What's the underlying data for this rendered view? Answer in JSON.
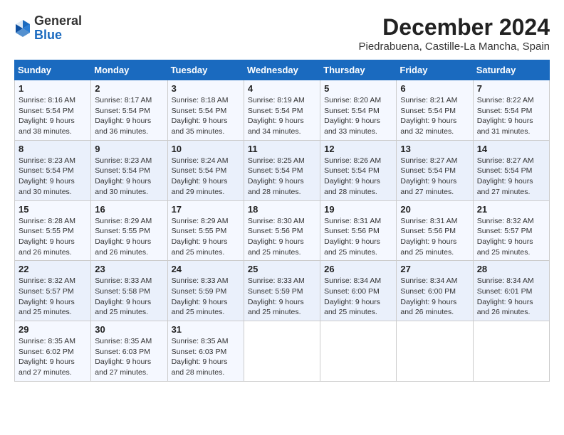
{
  "header": {
    "logo": {
      "line1": "General",
      "line2": "Blue"
    },
    "title": "December 2024",
    "subtitle": "Piedrabuena, Castille-La Mancha, Spain"
  },
  "calendar": {
    "days_of_week": [
      "Sunday",
      "Monday",
      "Tuesday",
      "Wednesday",
      "Thursday",
      "Friday",
      "Saturday"
    ],
    "weeks": [
      [
        null,
        {
          "day": "2",
          "sunrise": "8:17 AM",
          "sunset": "5:54 PM",
          "daylight": "9 hours and 36 minutes."
        },
        {
          "day": "3",
          "sunrise": "8:18 AM",
          "sunset": "5:54 PM",
          "daylight": "9 hours and 35 minutes."
        },
        {
          "day": "4",
          "sunrise": "8:19 AM",
          "sunset": "5:54 PM",
          "daylight": "9 hours and 34 minutes."
        },
        {
          "day": "5",
          "sunrise": "8:20 AM",
          "sunset": "5:54 PM",
          "daylight": "9 hours and 33 minutes."
        },
        {
          "day": "6",
          "sunrise": "8:21 AM",
          "sunset": "5:54 PM",
          "daylight": "9 hours and 32 minutes."
        },
        {
          "day": "7",
          "sunrise": "8:22 AM",
          "sunset": "5:54 PM",
          "daylight": "9 hours and 31 minutes."
        }
      ],
      [
        {
          "day": "1",
          "sunrise": "8:16 AM",
          "sunset": "5:54 PM",
          "daylight": "9 hours and 38 minutes."
        },
        {
          "day": "9",
          "sunrise": "8:23 AM",
          "sunset": "5:54 PM",
          "daylight": "9 hours and 30 minutes."
        },
        {
          "day": "10",
          "sunrise": "8:24 AM",
          "sunset": "5:54 PM",
          "daylight": "9 hours and 29 minutes."
        },
        {
          "day": "11",
          "sunrise": "8:25 AM",
          "sunset": "5:54 PM",
          "daylight": "9 hours and 28 minutes."
        },
        {
          "day": "12",
          "sunrise": "8:26 AM",
          "sunset": "5:54 PM",
          "daylight": "9 hours and 28 minutes."
        },
        {
          "day": "13",
          "sunrise": "8:27 AM",
          "sunset": "5:54 PM",
          "daylight": "9 hours and 27 minutes."
        },
        {
          "day": "14",
          "sunrise": "8:27 AM",
          "sunset": "5:54 PM",
          "daylight": "9 hours and 27 minutes."
        }
      ],
      [
        {
          "day": "8",
          "sunrise": "8:23 AM",
          "sunset": "5:54 PM",
          "daylight": "9 hours and 30 minutes."
        },
        {
          "day": "16",
          "sunrise": "8:29 AM",
          "sunset": "5:55 PM",
          "daylight": "9 hours and 26 minutes."
        },
        {
          "day": "17",
          "sunrise": "8:29 AM",
          "sunset": "5:55 PM",
          "daylight": "9 hours and 25 minutes."
        },
        {
          "day": "18",
          "sunrise": "8:30 AM",
          "sunset": "5:56 PM",
          "daylight": "9 hours and 25 minutes."
        },
        {
          "day": "19",
          "sunrise": "8:31 AM",
          "sunset": "5:56 PM",
          "daylight": "9 hours and 25 minutes."
        },
        {
          "day": "20",
          "sunrise": "8:31 AM",
          "sunset": "5:56 PM",
          "daylight": "9 hours and 25 minutes."
        },
        {
          "day": "21",
          "sunrise": "8:32 AM",
          "sunset": "5:57 PM",
          "daylight": "9 hours and 25 minutes."
        }
      ],
      [
        {
          "day": "15",
          "sunrise": "8:28 AM",
          "sunset": "5:55 PM",
          "daylight": "9 hours and 26 minutes."
        },
        {
          "day": "23",
          "sunrise": "8:33 AM",
          "sunset": "5:58 PM",
          "daylight": "9 hours and 25 minutes."
        },
        {
          "day": "24",
          "sunrise": "8:33 AM",
          "sunset": "5:59 PM",
          "daylight": "9 hours and 25 minutes."
        },
        {
          "day": "25",
          "sunrise": "8:33 AM",
          "sunset": "5:59 PM",
          "daylight": "9 hours and 25 minutes."
        },
        {
          "day": "26",
          "sunrise": "8:34 AM",
          "sunset": "6:00 PM",
          "daylight": "9 hours and 25 minutes."
        },
        {
          "day": "27",
          "sunrise": "8:34 AM",
          "sunset": "6:00 PM",
          "daylight": "9 hours and 26 minutes."
        },
        {
          "day": "28",
          "sunrise": "8:34 AM",
          "sunset": "6:01 PM",
          "daylight": "9 hours and 26 minutes."
        }
      ],
      [
        {
          "day": "22",
          "sunrise": "8:32 AM",
          "sunset": "5:57 PM",
          "daylight": "9 hours and 25 minutes."
        },
        {
          "day": "30",
          "sunrise": "8:35 AM",
          "sunset": "6:03 PM",
          "daylight": "9 hours and 27 minutes."
        },
        {
          "day": "31",
          "sunrise": "8:35 AM",
          "sunset": "6:03 PM",
          "daylight": "9 hours and 28 minutes."
        },
        null,
        null,
        null,
        null
      ],
      [
        {
          "day": "29",
          "sunrise": "8:35 AM",
          "sunset": "6:02 PM",
          "daylight": "9 hours and 27 minutes."
        },
        null,
        null,
        null,
        null,
        null,
        null
      ]
    ]
  }
}
